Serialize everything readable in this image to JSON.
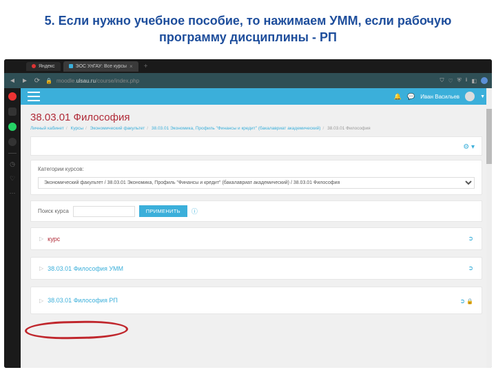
{
  "slide": {
    "title": "5. Если нужно учебное пособие, то нажимаем УММ, если рабочую программу дисциплины - РП"
  },
  "browser": {
    "tabs": [
      {
        "label": "Яндекс"
      },
      {
        "label": "ЭОС УлГАУ: Все курсы"
      }
    ],
    "url_host": "moodle.ulsau.ru",
    "url_path": "/course/index.php"
  },
  "moodle": {
    "user_name": "Иван Васильев",
    "page_title": "38.03.01 Философия",
    "breadcrumbs": {
      "b1": "Личный кабинет",
      "b2": "Курсы",
      "b3": "Экономический факультет",
      "b4": "38.03.01 Экономика, Профиль \"Финансы и кредит\" (бакалавриат академический)",
      "b5": "38.03.01 Философия"
    },
    "category_label": "Категории курсов:",
    "category_value": "Экономический факультет / 38.03.01 Экономика, Профиль \"Финансы и кредит\" (бакалавриат академический) / 38.03.01 Философия",
    "search_label": "Поиск курса",
    "apply_label": "ПРИМЕНИТЬ",
    "courses": {
      "c1": "курс",
      "c2": "38.03.01 Философия УММ",
      "c3": "38.03.01 Философия РП"
    }
  }
}
